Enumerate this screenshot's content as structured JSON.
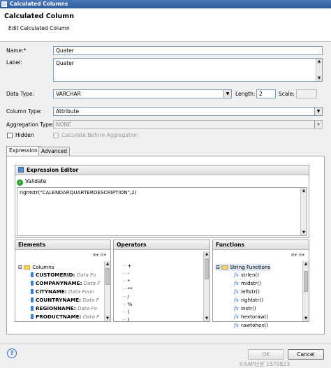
{
  "window": {
    "title": "Calculated Columns"
  },
  "banner": {
    "title": "Calculated Column",
    "subtitle": "Edit Calculated Column"
  },
  "form": {
    "name_label": "Name:*",
    "name_value": "Quater",
    "label_label": "Label:",
    "label_value": "Quater",
    "datatype_label": "Data Type:",
    "datatype_value": "VARCHAR",
    "length_label": "Length:",
    "length_value": "2",
    "scale_label": "Scale:",
    "coltype_label": "Column Type:",
    "coltype_value": "Attribute",
    "aggtype_label": "Aggregation Type:",
    "aggtype_value": "NONE",
    "hidden_label": "Hidden",
    "calc_before_agg_label": "Calculate Before Aggregation"
  },
  "tabs": [
    {
      "label": "Expression"
    },
    {
      "label": "Advanced"
    }
  ],
  "expression_editor": {
    "title": "Expression Editor",
    "validate_label": "Validate",
    "expression": "rightstr(\"CALENDARQUARTERDESCRIPTION\",2)"
  },
  "elements": {
    "title": "Elements",
    "folder": "Columns",
    "rows": [
      {
        "name": "CUSTOMERID:",
        "type": "Data Fo"
      },
      {
        "name": "COMPANYNAME:",
        "type": "Data F"
      },
      {
        "name": "CITYNAME:",
        "type": "Data Foun"
      },
      {
        "name": "COUNTRYNAME:",
        "type": "Data F"
      },
      {
        "name": "REGIONNAME:",
        "type": "Data Fo"
      },
      {
        "name": "PRODUCTNAME:",
        "type": "Data F"
      }
    ]
  },
  "operators": {
    "title": "Operators",
    "items": [
      "+",
      "-",
      "*",
      "**",
      "/",
      "%",
      "(",
      ")"
    ]
  },
  "functions": {
    "title": "Functions",
    "folder": "String Functions",
    "items": [
      "strlen()",
      "midstr()",
      "leftstr()",
      "rightstr()",
      "instr()",
      "hextoraw()",
      "rawtohex()"
    ]
  },
  "footer": {
    "help_icon": "?",
    "ok_label": "OK",
    "cancel_label": "Cancel",
    "watermark": "©SAP社区 1570823"
  }
}
